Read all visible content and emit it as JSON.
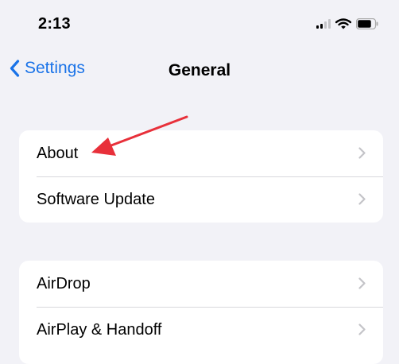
{
  "status_bar": {
    "time": "2:13"
  },
  "nav": {
    "back_label": "Settings",
    "title": "General"
  },
  "groups": [
    {
      "rows": [
        {
          "label": "About"
        },
        {
          "label": "Software Update"
        }
      ]
    },
    {
      "rows": [
        {
          "label": "AirDrop"
        },
        {
          "label": "AirPlay & Handoff"
        }
      ]
    }
  ],
  "icons": {
    "back": "chevron-left-icon",
    "row": "chevron-right-icon",
    "signal": "cellular-signal-icon",
    "wifi": "wifi-icon",
    "battery": "battery-icon",
    "annotation": "red-arrow-annotation"
  },
  "colors": {
    "background": "#f2f2f7",
    "accent": "#1a73e8",
    "annotation": "#e8303a",
    "chevron": "#c4c4c8"
  }
}
